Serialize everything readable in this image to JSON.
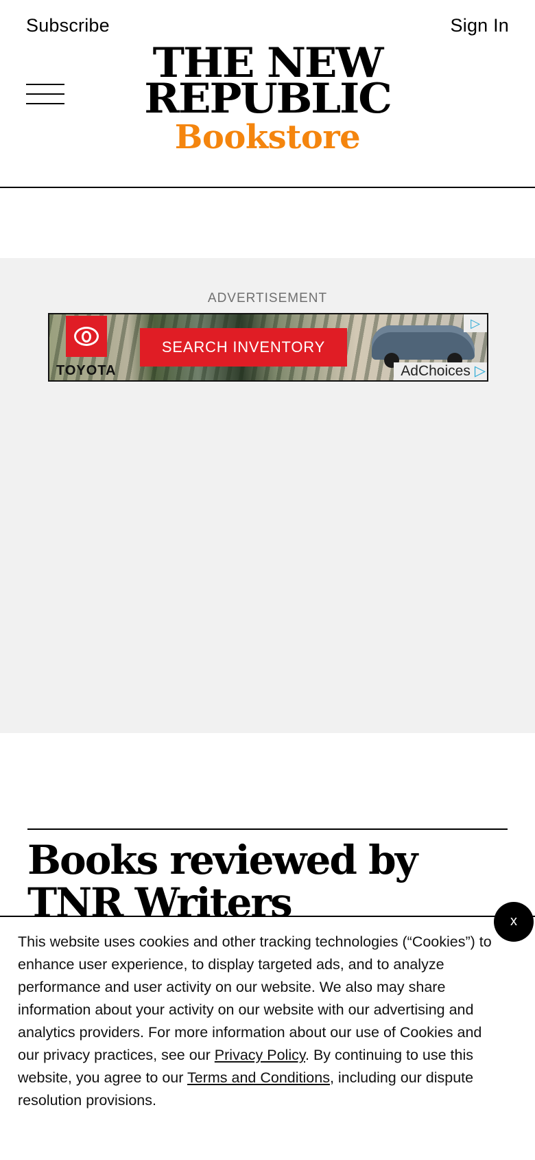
{
  "header": {
    "subscribe_label": "Subscribe",
    "sign_in_label": "Sign In",
    "menu_icon": "hamburger-menu-icon",
    "logo": {
      "line1": "THE NEW",
      "line2": "REPUBLIC",
      "line3": "Bookstore"
    }
  },
  "advertisement": {
    "label": "ADVERTISEMENT",
    "banner": {
      "brand": "TOYOTA",
      "cta_label": "SEARCH INVENTORY",
      "adchoices_label": "AdChoices",
      "adchoices_icon": "adchoices-triangle-icon"
    }
  },
  "main": {
    "title": "Books reviewed by TNR Writers"
  },
  "cookie_notice": {
    "text_before_privacy": "This website uses cookies and other tracking technologies (“Cookies”) to enhance user experience, to display targeted ads, and to analyze performance and user activity on our website. We also may share information about your activity on our website with our advertising and analytics providers. For more information about our use of Cookies and our privacy practices, see our ",
    "privacy_link": "Privacy Policy",
    "text_between": ". By continuing to use this website, you agree to our ",
    "terms_link": "Terms and Conditions",
    "text_after": ", including our dispute resolution provisions.",
    "close_label": "x"
  },
  "colors": {
    "brand_orange": "#f4850e",
    "ad_background": "#f1f1f1",
    "toyota_red": "#e01d25",
    "text": "#000000"
  }
}
